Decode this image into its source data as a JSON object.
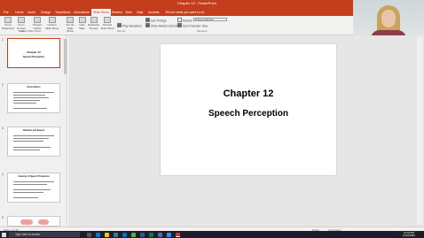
{
  "window": {
    "title": "Chapter 12 - PowerPoint"
  },
  "ribbon": {
    "tabs": [
      "File",
      "Home",
      "Insert",
      "Design",
      "Transitions",
      "Animations",
      "Slide Show",
      "Review",
      "View",
      "Help",
      "Acrobat"
    ],
    "active_tab": "Slide Show",
    "tell_me": "Tell me what you want to do",
    "start_group": {
      "label": "Start Slide Show",
      "buttons": [
        "From Beginning",
        "From Current Slide",
        "Present Online",
        "Custom Slide Show"
      ]
    },
    "setup_group": {
      "label": "Set Up",
      "buttons": [
        "Set Up Slide Show",
        "Hide Slide",
        "Rehearse Timings",
        "Record Slide Show"
      ],
      "checks": [
        {
          "label": "Play Narrations",
          "checked": true
        },
        {
          "label": "Use Timings",
          "checked": true
        },
        {
          "label": "Show Media Controls",
          "checked": true
        }
      ]
    },
    "monitors_group": {
      "label": "Monitors",
      "monitor_label": "Monitor:",
      "monitor_value": "Primary Monitor",
      "presenter_view": "Use Presenter View"
    }
  },
  "webcam": {
    "name": "Shannon McGillivray"
  },
  "slides": [
    {
      "number": "1",
      "title": "Chapter 12",
      "subtitle": "Speech Perception"
    },
    {
      "number": "2",
      "title": "Some Basics"
    },
    {
      "number": "3",
      "title": "Vibration and Speech"
    },
    {
      "number": "4",
      "title": "Anatomy of Speech Production"
    },
    {
      "number": "5",
      "title": ""
    }
  ],
  "current_slide": {
    "title": "Chapter 12",
    "subtitle": "Speech Perception"
  },
  "status": {
    "slide_count": "Slide 1 of 40",
    "notes": "Notes",
    "comments": "Comments"
  },
  "taskbar": {
    "search_placeholder": "Type here to search",
    "time": "12:18 PM",
    "date": "11/12/2020"
  },
  "colors": {
    "accent": "#c43e1c",
    "ribbon_bg": "#f3f2f1",
    "editor_bg": "#e6e6e6"
  }
}
